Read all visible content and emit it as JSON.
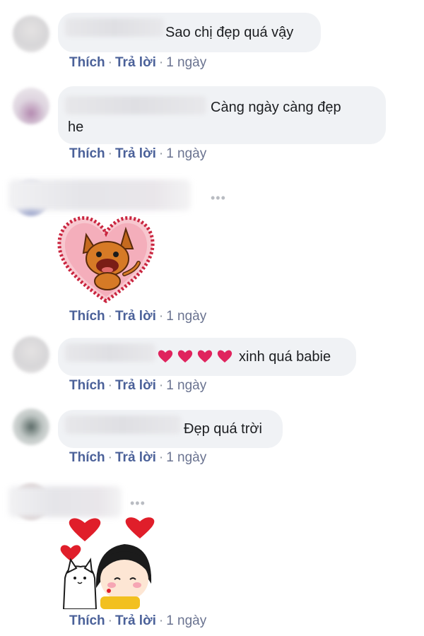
{
  "comments": [
    {
      "text": "Sao chị đẹp quá vậy",
      "like": "Thích",
      "reply": "Trả lời",
      "time": "1 ngày"
    },
    {
      "text_line1": "Càng ngày càng đẹp",
      "text_line2": "he",
      "like": "Thích",
      "reply": "Trả lời",
      "time": "1 ngày"
    },
    {
      "sticker": "heart-fox-sticker",
      "more": "•••",
      "like": "Thích",
      "reply": "Trả lời",
      "time": "1 ngày"
    },
    {
      "emoji": "red-heart-icon x4",
      "text": "xinh quá babie",
      "like": "Thích",
      "reply": "Trả lời",
      "time": "1 ngày"
    },
    {
      "text": "Đẹp quá trời",
      "like": "Thích",
      "reply": "Trả lời",
      "time": "1 ngày"
    },
    {
      "sticker": "girl-hugging-cat-sticker",
      "more": "•••",
      "like": "Thích",
      "reply": "Trả lời",
      "time": "1 ngày"
    }
  ],
  "colors": {
    "bubble": "#f0f2f5",
    "link": "#4b6199",
    "meta": "#6a7390",
    "heart": "#e0245e"
  },
  "separator": "·"
}
